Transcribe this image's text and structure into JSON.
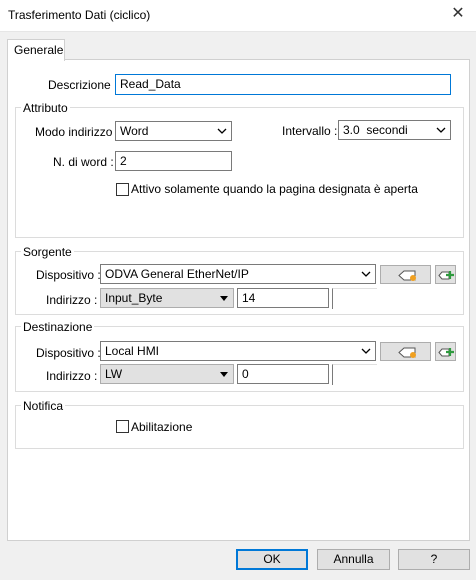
{
  "window": {
    "title": "Trasferimento Dati (ciclico)",
    "close_glyph": "✕"
  },
  "tabs": [
    {
      "label": "Generale"
    }
  ],
  "general": {
    "descrizione_label": "Descrizione :",
    "descrizione_value": "Read_Data"
  },
  "attributo": {
    "title": "Attributo",
    "modo_label": "Modo indirizzo :",
    "modo_value": "Word",
    "intervallo_label": "Intervallo :",
    "intervallo_value": "3.0  secondi",
    "nword_label": "N. di word :",
    "nword_value": "2",
    "checkbox_label": "Attivo solamente quando la pagina designata è aperta",
    "checkbox_checked": false
  },
  "sorgente": {
    "title": "Sorgente",
    "dispositivo_label": "Dispositivo :",
    "dispositivo_value": "ODVA General EtherNet/IP",
    "indirizzo_label": "Indirizzo :",
    "indirizzo_type": "Input_Byte",
    "indirizzo_value": "14"
  },
  "destinazione": {
    "title": "Destinazione",
    "dispositivo_label": "Dispositivo :",
    "dispositivo_value": "Local HMI",
    "indirizzo_label": "Indirizzo :",
    "indirizzo_type": "LW",
    "indirizzo_value": "0"
  },
  "notifica": {
    "title": "Notifica",
    "checkbox_label": "Abilitazione",
    "checkbox_checked": false
  },
  "buttons": {
    "ok": "OK",
    "cancel": "Annulla",
    "help": "?"
  },
  "icons": {
    "settings": "device-settings-icon",
    "add": "add-device-icon"
  },
  "colors": {
    "focus": "#0078d7",
    "icon_orange": "#f0a020",
    "icon_green": "#2e9a3e"
  }
}
